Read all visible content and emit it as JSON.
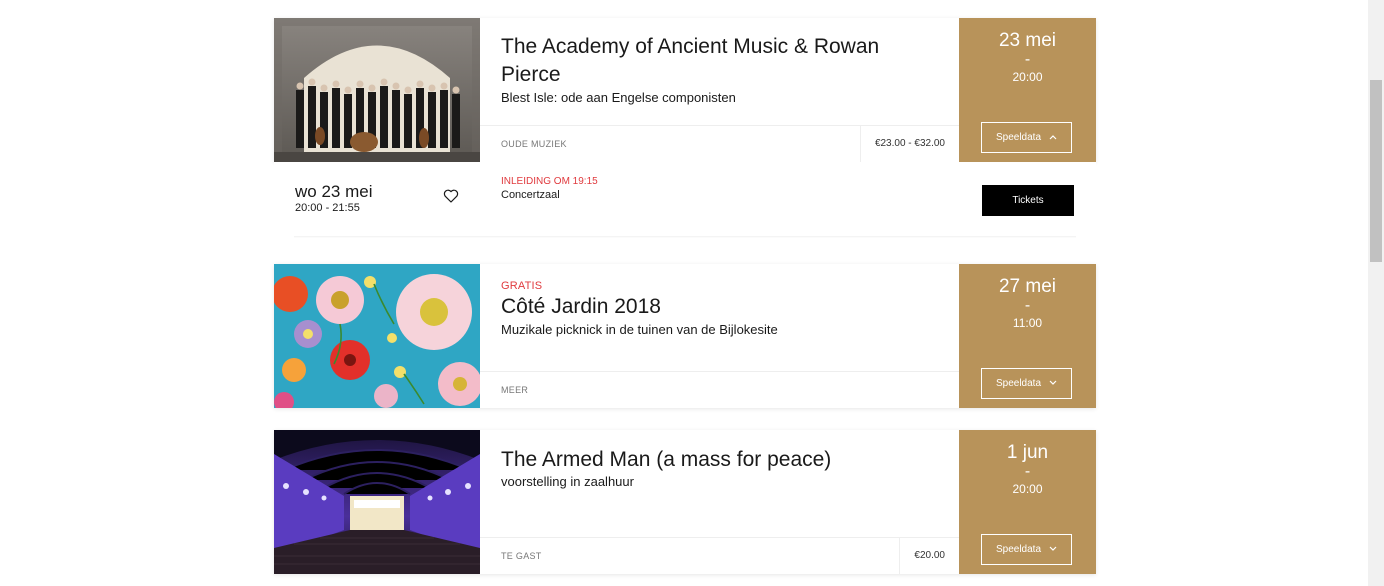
{
  "colors": {
    "gold": "#b8935a",
    "red_label": "#e03a3e",
    "black": "#000000"
  },
  "events": [
    {
      "label": "",
      "title": "The Academy of Ancient Music & Rowan Pierce",
      "subtitle": "Blest Isle: ode aan Engelse componisten",
      "category": "OUDE MUZIEK",
      "price": "€23.00 - €32.00",
      "date": "23 mei",
      "dash": "-",
      "time": "20:00",
      "speeldata_label": "Speeldata",
      "speeldata_icon": "chevron-up-icon"
    },
    {
      "label": "GRATIS",
      "title": "Côté Jardin 2018",
      "subtitle": "Muzikale picknick in de tuinen van de Bijlokesite",
      "category": "MEER",
      "price": "",
      "date": "27 mei",
      "dash": "-",
      "time": "11:00",
      "speeldata_label": "Speeldata",
      "speeldata_icon": "chevron-down-icon"
    },
    {
      "label": "",
      "title": "The Armed Man (a mass for peace)",
      "subtitle": "voorstelling in zaalhuur",
      "category": "TE GAST",
      "price": "€20.00",
      "date": "1 jun",
      "dash": "-",
      "time": "20:00",
      "speeldata_label": "Speeldata",
      "speeldata_icon": "chevron-down-icon"
    }
  ],
  "schedule": {
    "day": "wo 23 mei",
    "hours": "20:00 - 21:55",
    "intro": "INLEIDING OM 19:15",
    "hall": "Concertzaal",
    "tickets_label": "Tickets",
    "favorite_icon": "heart-icon"
  }
}
